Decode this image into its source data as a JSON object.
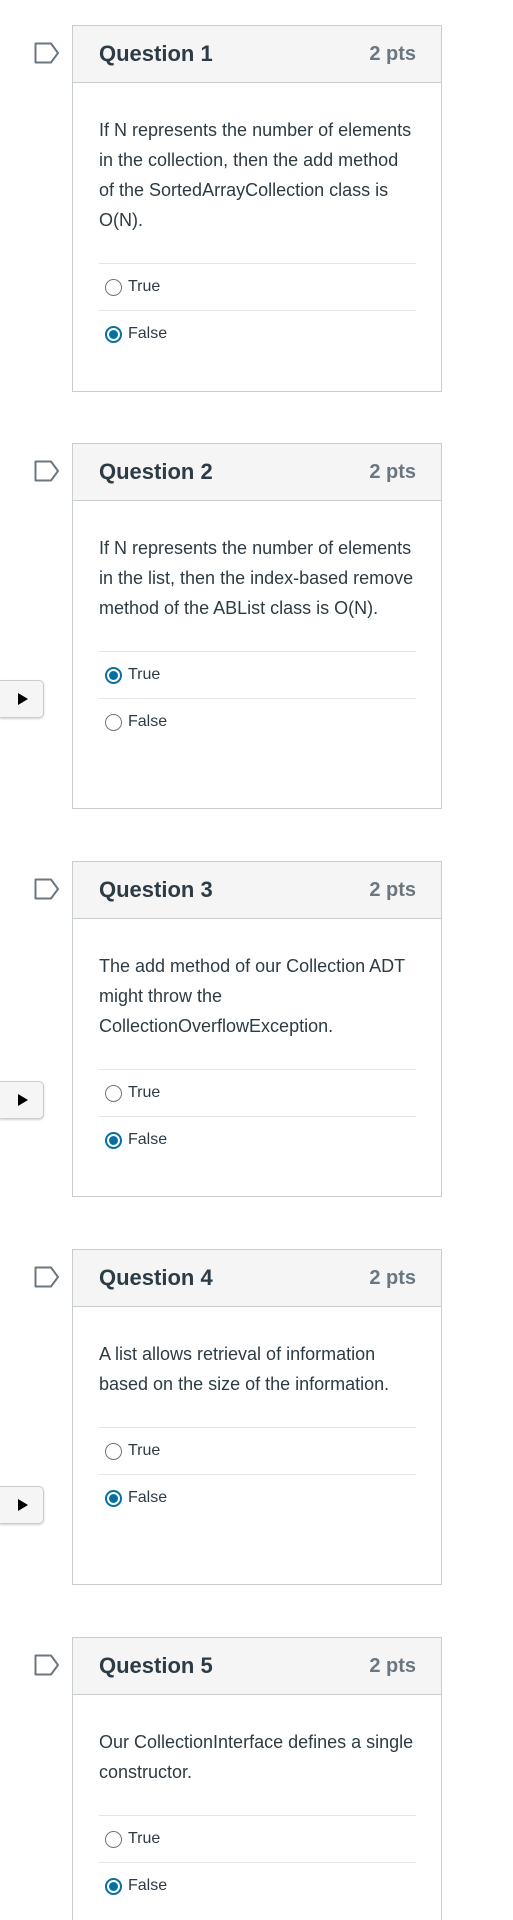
{
  "colors": {
    "accent": "#0770a3",
    "header_bg": "#f5f5f5",
    "border": "#c7cdd1",
    "text": "#2d3b45",
    "muted_text": "#6b7780"
  },
  "icons": {
    "flag": "flag-outline-icon",
    "play": "play-triangle-icon"
  },
  "questions": [
    {
      "title": "Question 1",
      "points": "2 pts",
      "text": "If N represents the number of elements in the collection, then the add method of the SortedArrayCollection class is O(N).",
      "answers": [
        {
          "label": "True",
          "selected": false
        },
        {
          "label": "False",
          "selected": true
        }
      ]
    },
    {
      "title": "Question 2",
      "points": "2 pts",
      "text": "If N represents the number of elements in the list, then the index-based remove method of the ABList class is O(N).",
      "answers": [
        {
          "label": "True",
          "selected": true
        },
        {
          "label": "False",
          "selected": false
        }
      ]
    },
    {
      "title": "Question 3",
      "points": "2 pts",
      "text": "The add method of our Collection ADT might throw the CollectionOverflowException.",
      "answers": [
        {
          "label": "True",
          "selected": false
        },
        {
          "label": "False",
          "selected": true
        }
      ]
    },
    {
      "title": "Question 4",
      "points": "2 pts",
      "text": "A list allows retrieval of information based on the size of the information.",
      "answers": [
        {
          "label": "True",
          "selected": false
        },
        {
          "label": "False",
          "selected": true
        }
      ]
    },
    {
      "title": "Question 5",
      "points": "2 pts",
      "text": "Our CollectionInterface defines a single constructor.",
      "answers": [
        {
          "label": "True",
          "selected": false
        },
        {
          "label": "False",
          "selected": true
        }
      ]
    }
  ]
}
